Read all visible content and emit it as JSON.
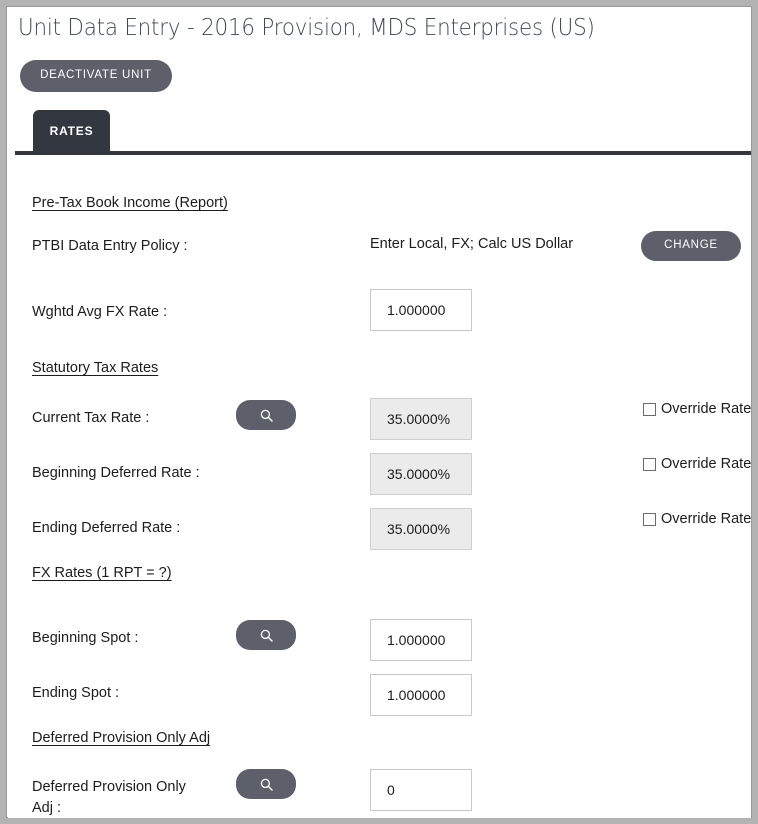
{
  "window": {
    "title": "Unit Data Entry - 2016 Provision, MDS Enterprises (US)"
  },
  "header": {
    "deactivate_label": "DEACTIVATE UNIT"
  },
  "tabs": [
    {
      "label": "RATES",
      "active": true
    }
  ],
  "sections": {
    "ptbi": {
      "heading": "Pre-Tax Book Income (Report)",
      "policy_label": "PTBI Data Entry Policy :",
      "policy_value": "Enter Local, FX; Calc US Dollar",
      "change_button": "CHANGE",
      "wghtd_label": "Wghtd Avg FX Rate :",
      "wghtd_value": "1.000000"
    },
    "statutory": {
      "heading": "Statutory Tax Rates",
      "override_label": "Override Rate",
      "rows": [
        {
          "label": "Current Tax Rate :",
          "value": "35.0000%",
          "has_search": true,
          "override_checked": false
        },
        {
          "label": "Beginning Deferred Rate :",
          "value": "35.0000%",
          "has_search": false,
          "override_checked": false
        },
        {
          "label": "Ending Deferred Rate :",
          "value": "35.0000%",
          "has_search": false,
          "override_checked": false
        }
      ]
    },
    "fx": {
      "heading": "FX Rates (1 RPT = ?)",
      "rows": [
        {
          "label": "Beginning Spot :",
          "value": "1.000000",
          "has_search": true
        },
        {
          "label": "Ending Spot :",
          "value": "1.000000",
          "has_search": false
        }
      ]
    },
    "deferred": {
      "heading": "Deferred Provision Only Adj",
      "row_label": "Deferred Provision Only Adj :",
      "value": "0"
    }
  },
  "icons": {
    "search": "search-icon"
  },
  "colors": {
    "accent_dark": "#5d5f6b",
    "tab_dark": "#333840",
    "frame_gray": "#b3b3b3",
    "readonly_fill": "#ebebeb",
    "text": "#1c1c1c"
  }
}
